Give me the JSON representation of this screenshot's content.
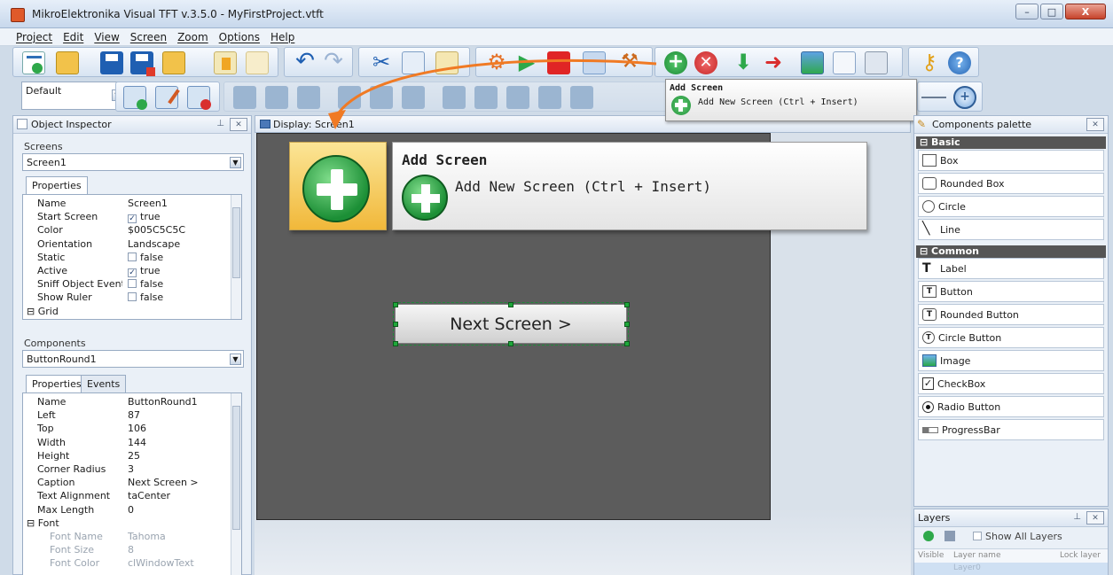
{
  "window": {
    "title": "MikroElektronika Visual TFT v.3.5.0 - MyFirstProject.vtft",
    "controls": [
      "–",
      "□",
      "X"
    ]
  },
  "menu": [
    "Project",
    "Edit",
    "View",
    "Screen",
    "Zoom",
    "Options",
    "Help"
  ],
  "toolbar2": {
    "style_value": "Default"
  },
  "object_inspector": {
    "title": "Object Inspector",
    "screens_label": "Screens",
    "screen_selected": "Screen1",
    "screens_tab": "Properties",
    "screen_props": [
      {
        "name": "Name",
        "value": "Screen1"
      },
      {
        "name": "Start Screen",
        "value": "true",
        "check": "✓"
      },
      {
        "name": "Color",
        "value": "$005C5C5C"
      },
      {
        "name": "Orientation",
        "value": "Landscape"
      },
      {
        "name": "Static",
        "value": "false",
        "check": ""
      },
      {
        "name": "Active",
        "value": "true",
        "check": "✓"
      },
      {
        "name": "Sniff Object Events",
        "value": "false",
        "check": ""
      },
      {
        "name": "Show Ruler",
        "value": "false",
        "check": ""
      },
      {
        "name": "Grid",
        "value": ""
      }
    ],
    "components_label": "Components",
    "component_selected": "ButtonRound1",
    "comp_tab_props": "Properties",
    "comp_tab_events": "Events",
    "comp_props": [
      {
        "name": "Name",
        "value": "ButtonRound1"
      },
      {
        "name": "Left",
        "value": "87"
      },
      {
        "name": "Top",
        "value": "106"
      },
      {
        "name": "Width",
        "value": "144"
      },
      {
        "name": "Height",
        "value": "25"
      },
      {
        "name": "Corner Radius",
        "value": "3"
      },
      {
        "name": "Caption",
        "value": "Next Screen >"
      },
      {
        "name": "Text Alignment",
        "value": "taCenter"
      },
      {
        "name": "Max Length",
        "value": "0"
      },
      {
        "name": "Font",
        "value": ""
      }
    ],
    "font_props": [
      {
        "name": "Font Name",
        "value": "Tahoma"
      },
      {
        "name": "Font Size",
        "value": "8"
      },
      {
        "name": "Font Color",
        "value": "clWindowText"
      }
    ]
  },
  "display": {
    "title": "Display: Screen1",
    "button_caption": "Next Screen >"
  },
  "tooltip": {
    "title": "Add Screen",
    "description": "Add New Screen (Ctrl + Insert)"
  },
  "palette": {
    "title": "Components palette",
    "basic_label": "Basic",
    "basic_items": [
      "Box",
      "Rounded Box",
      "Circle",
      "Line"
    ],
    "common_label": "Common",
    "common_items": [
      "Label",
      "Button",
      "Rounded Button",
      "Circle Button",
      "Image",
      "CheckBox",
      "Radio Button",
      "ProgressBar"
    ]
  },
  "layers": {
    "title": "Layers",
    "show_all": "Show All Layers",
    "col_visible": "Visible",
    "col_name": "Layer name",
    "col_lock": "Lock layer",
    "row_name": "Layer0"
  },
  "colors": {
    "screen_bg": "#5c5c5c",
    "accent_green": "#2ea84a",
    "accent_orange": "#f07a24"
  }
}
